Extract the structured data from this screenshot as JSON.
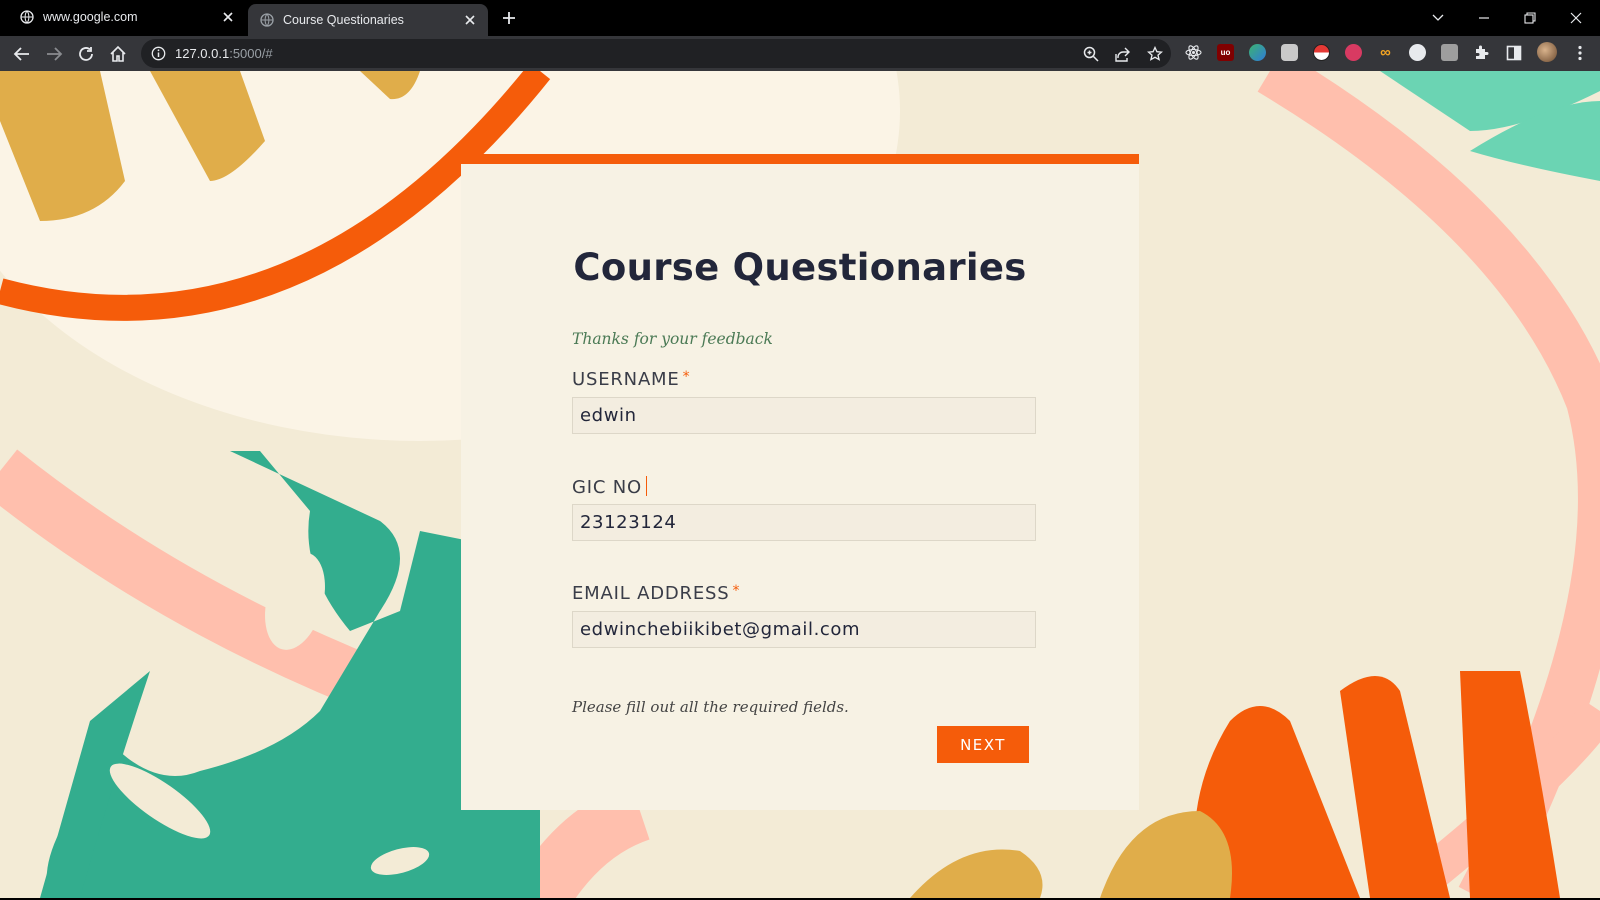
{
  "browser": {
    "tabs": [
      {
        "title": "www.google.com",
        "active": false
      },
      {
        "title": "Course Questionaries",
        "active": true
      }
    ],
    "url_host": "127.0.0.1",
    "url_path": ":5000/#",
    "extensions": [
      "react-devtools",
      "ublock-origin",
      "extension-green",
      "extension-cloud",
      "pokeball",
      "extension-blocked",
      "infinity",
      "extension-circle",
      "extension-card"
    ]
  },
  "colors": {
    "accent": "#f55c0a",
    "leaf_green": "#33ad8e",
    "mint": "#6bd4b3",
    "pink": "#ffbfad",
    "mustard": "#e0ad4a",
    "cream": "#f3ebd6"
  },
  "form": {
    "title": "Course Questionaries",
    "message": "Thanks for your feedback",
    "fields": [
      {
        "label": "USERNAME",
        "required_mark": "*",
        "value": "edwin"
      },
      {
        "label": "GIC NO",
        "required_mark": "",
        "value": "23123124"
      },
      {
        "label": "EMAIL ADDRESS",
        "required_mark": "*",
        "value": "edwinchebiikibet@gmail.com"
      }
    ],
    "hint": "Please fill out all the required fields.",
    "next_label": "NEXT"
  }
}
